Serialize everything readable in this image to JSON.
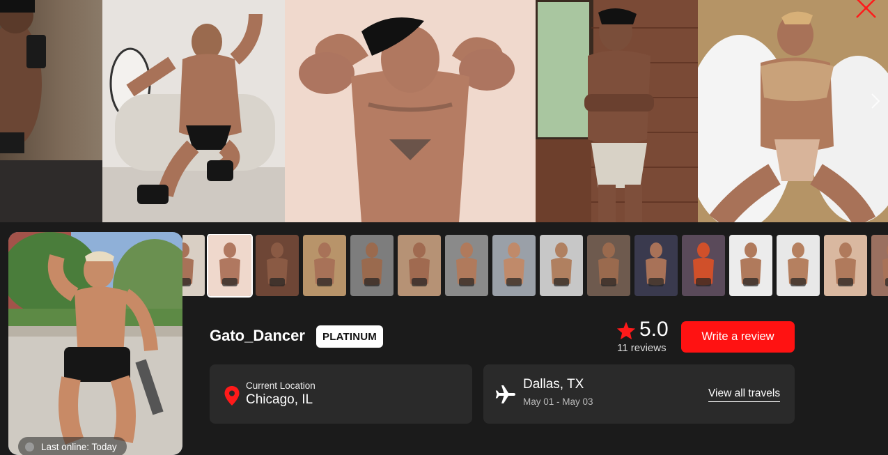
{
  "gallery": {
    "close_icon": "close-icon",
    "next_icon": "chevron-right-icon"
  },
  "profile": {
    "name": "Gato_Dancer",
    "tier": "PLATINUM",
    "last_online": "Last online: Today",
    "rating": {
      "value": "5.0",
      "reviews": "11 reviews",
      "star_color": "#ff1a1a"
    },
    "write_review_label": "Write a review",
    "location": {
      "label": "Current Location",
      "value": "Chicago, IL"
    },
    "travel": {
      "city": "Dallas, TX",
      "dates": "May 01 - May 03",
      "view_all_label": "View all travels"
    }
  },
  "colors": {
    "accent": "#ff1212",
    "background": "#1b1b1b",
    "card": "#2a2a2a"
  },
  "thumbnails_count": 17,
  "active_thumbnail_index": 1
}
